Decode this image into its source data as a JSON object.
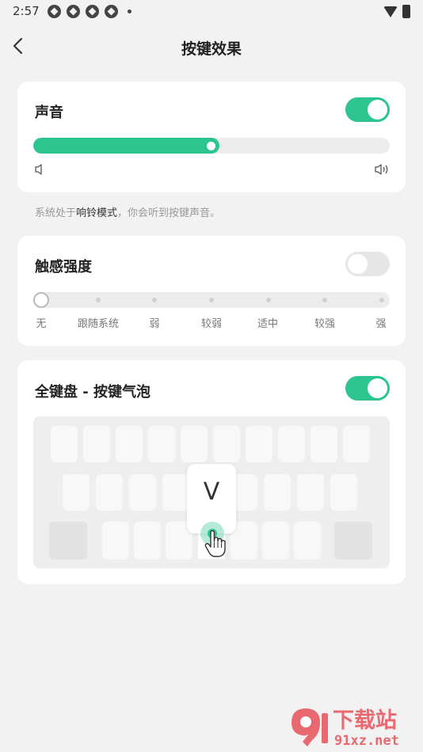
{
  "status_bar": {
    "time": "2:57"
  },
  "header": {
    "title": "按键效果"
  },
  "sound_card": {
    "title": "声音",
    "toggle_on": true,
    "volume_level": 0.5
  },
  "hint": {
    "prefix": "系统处于",
    "mode": "响铃模式",
    "suffix": "，你会听到按键声音。"
  },
  "haptic_card": {
    "title": "触感强度",
    "toggle_on": false,
    "levels": [
      "无",
      "跟随系统",
      "弱",
      "较弱",
      "适中",
      "较强",
      "强"
    ],
    "selected_level": "无"
  },
  "bubble_card": {
    "title": "全键盘 - 按键气泡",
    "toggle_on": true,
    "preview_key": "V"
  },
  "watermark": {
    "brand": "下载站",
    "domain": "91xz.net"
  },
  "colors": {
    "accent": "#2cc58f",
    "background": "#f2f2f2",
    "card": "#ffffff"
  }
}
